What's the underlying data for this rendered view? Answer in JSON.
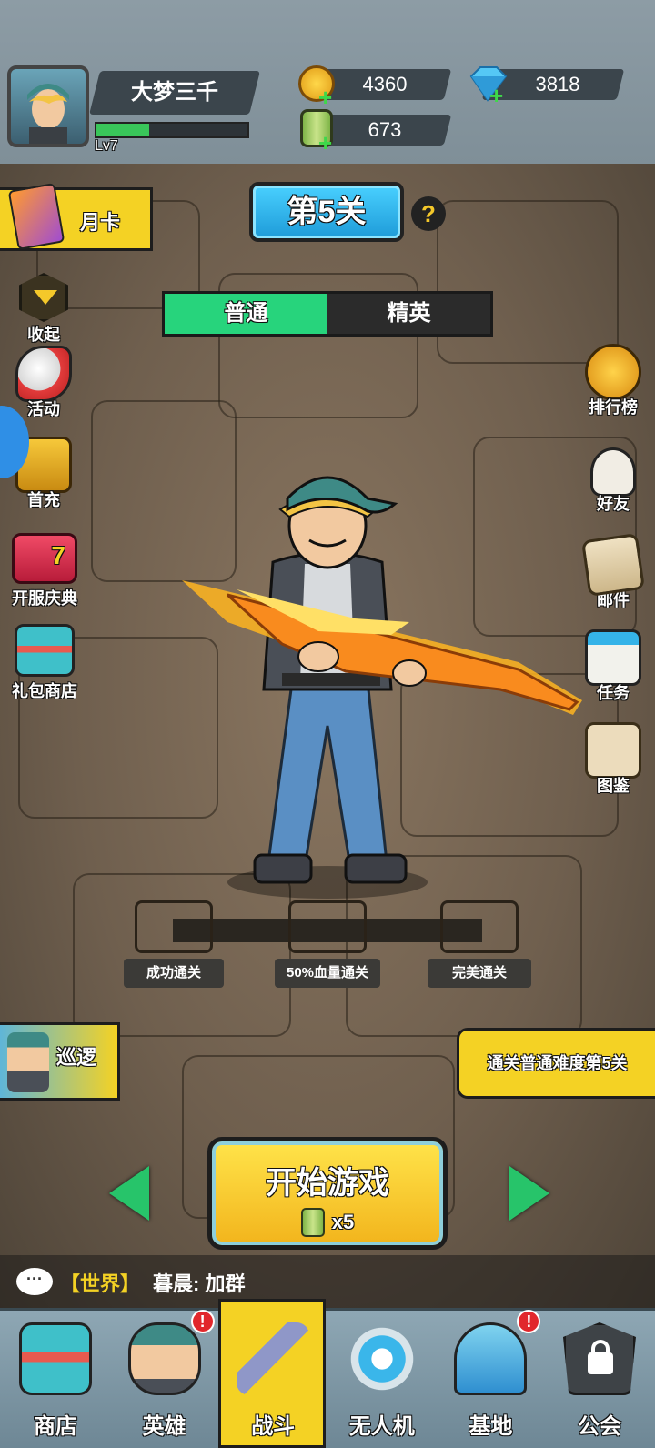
{
  "player": {
    "name": "大梦三千",
    "level": "Lv7",
    "xp_progress": 0.35
  },
  "currency": {
    "gold": "4360",
    "diamond": "3818",
    "energy": "673"
  },
  "stage": {
    "title": "第5关",
    "help": "?"
  },
  "difficulty_tabs": [
    {
      "label": "普通",
      "active": true
    },
    {
      "label": "精英",
      "active": false
    }
  ],
  "monthly_card": {
    "label": "月卡"
  },
  "left_menu": [
    {
      "label": "收起",
      "icon": "chevron-down-icon"
    },
    {
      "label": "活动",
      "icon": "megaphone-icon"
    },
    {
      "label": "首充",
      "icon": "treasure-chest-icon"
    },
    {
      "label": "开服庆典",
      "icon": "gift-box-icon",
      "badge": "7"
    },
    {
      "label": "礼包商店",
      "icon": "shop-icon"
    }
  ],
  "right_menu": [
    {
      "label": "排行榜",
      "icon": "trophy-icon"
    },
    {
      "label": "好友",
      "icon": "friends-icon"
    },
    {
      "label": "邮件",
      "icon": "mail-icon"
    },
    {
      "label": "任务",
      "icon": "calendar-icon"
    },
    {
      "label": "图鉴",
      "icon": "book-icon"
    }
  ],
  "rewards": [
    {
      "label": "成功通关",
      "color": "#8a5a34"
    },
    {
      "label": "50%血量通关",
      "color": "#2f7d8c"
    },
    {
      "label": "完美通关",
      "color": "#d4b42c"
    }
  ],
  "patrol": {
    "label": "巡逻"
  },
  "objective": {
    "text": "通关普通难度第5关"
  },
  "start": {
    "label": "开始游戏",
    "cost": "x5"
  },
  "chat": {
    "channel": "【世界】",
    "message": "暮晨: 加群"
  },
  "bottom_nav": [
    {
      "label": "商店",
      "icon": "shop-icon",
      "active": false,
      "badge": false
    },
    {
      "label": "英雄",
      "icon": "hero-icon",
      "active": false,
      "badge": true
    },
    {
      "label": "战斗",
      "icon": "rifle-icon",
      "active": true,
      "badge": false
    },
    {
      "label": "无人机",
      "icon": "drone-icon",
      "active": false,
      "badge": false
    },
    {
      "label": "基地",
      "icon": "dome-base-icon",
      "active": false,
      "badge": true
    },
    {
      "label": "公会",
      "icon": "lock-icon",
      "active": false,
      "badge": false
    }
  ],
  "colors": {
    "accent_green": "#27d47c",
    "stage_blue": "#2db9ea",
    "yellow": "#f4d224",
    "badge_red": "#e1272c"
  }
}
